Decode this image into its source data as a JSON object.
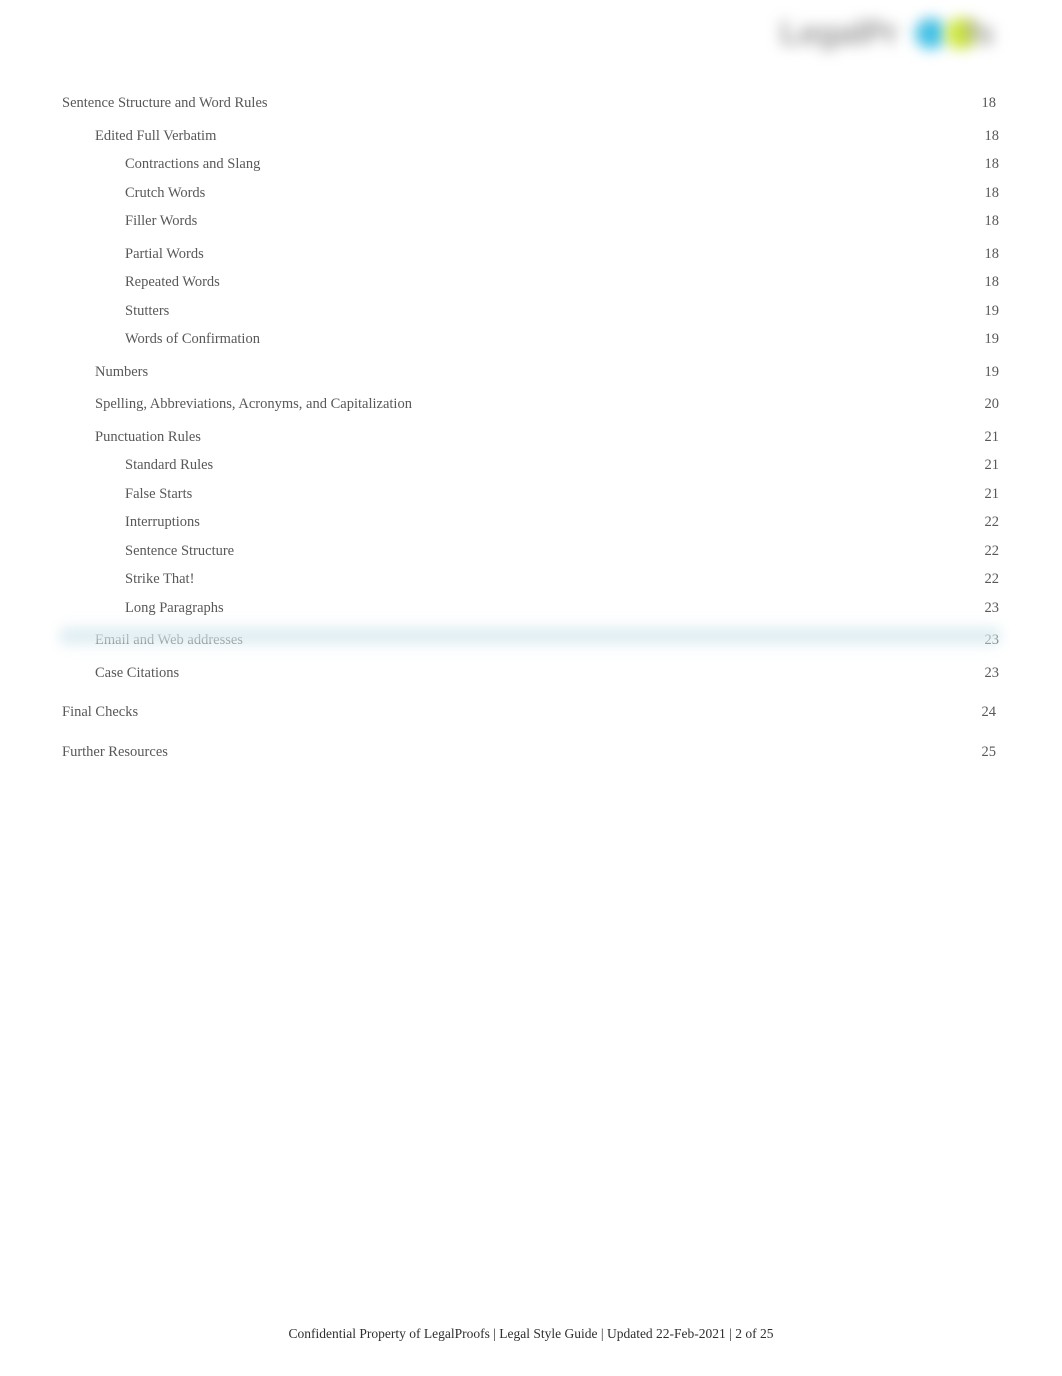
{
  "document": {
    "logo": {
      "text_before": "LegalPr",
      "text_after": "fs",
      "dot_cyan_color": "#45c1e6",
      "dot_lime_color": "#cfe83f",
      "text_color": "#9a9a9a"
    },
    "text_color": "#585858",
    "footer": {
      "text": "Confidential Property of LegalProofs | Legal Style Guide | Updated 22-Feb-2021 | 2 of 25"
    }
  },
  "toc": {
    "entries": [
      {
        "label": "Sentence Structure and Word Rules",
        "page": "18",
        "level": 1,
        "gap": ""
      },
      {
        "label": "Edited Full Verbatim",
        "page": "18",
        "level": 2,
        "gap": ""
      },
      {
        "label": "Contractions and Slang",
        "page": "18",
        "level": 3,
        "gap": ""
      },
      {
        "label": "Crutch Words",
        "page": "18",
        "level": 3,
        "gap": ""
      },
      {
        "label": "Filler Words",
        "page": "18",
        "level": 3,
        "gap": ""
      },
      {
        "label": "Partial Words",
        "page": "18",
        "level": 3,
        "gap": "gap-md"
      },
      {
        "label": "Repeated Words",
        "page": "18",
        "level": 3,
        "gap": ""
      },
      {
        "label": "Stutters",
        "page": "19",
        "level": 3,
        "gap": ""
      },
      {
        "label": "Words of Confirmation",
        "page": "19",
        "level": 3,
        "gap": ""
      },
      {
        "label": "Numbers",
        "page": "19",
        "level": 2,
        "gap": ""
      },
      {
        "label": "Spelling, Abbreviations, Acronyms, and Capitalization",
        "page": "20",
        "level": 2,
        "gap": ""
      },
      {
        "label": "Punctuation Rules",
        "page": "21",
        "level": 2,
        "gap": ""
      },
      {
        "label": "Standard Rules",
        "page": "21",
        "level": 3,
        "gap": ""
      },
      {
        "label": "False Starts",
        "page": "21",
        "level": 3,
        "gap": ""
      },
      {
        "label": "Interruptions",
        "page": "22",
        "level": 3,
        "gap": ""
      },
      {
        "label": "Sentence Structure",
        "page": "22",
        "level": 3,
        "gap": ""
      },
      {
        "label": "Strike That!",
        "page": "22",
        "level": 3,
        "gap": ""
      },
      {
        "label": "Long Paragraphs",
        "page": "23",
        "level": 3,
        "gap": ""
      },
      {
        "label": "Email and Web addresses",
        "page": "23",
        "level": 2,
        "gap": ""
      },
      {
        "label": "Case Citations",
        "page": "23",
        "level": 2,
        "gap": ""
      },
      {
        "label": "Final Checks",
        "page": "24",
        "level": 1,
        "gap": "gap-lg"
      },
      {
        "label": "Further Resources",
        "page": "25",
        "level": 1,
        "gap": "gap-lg"
      }
    ]
  }
}
